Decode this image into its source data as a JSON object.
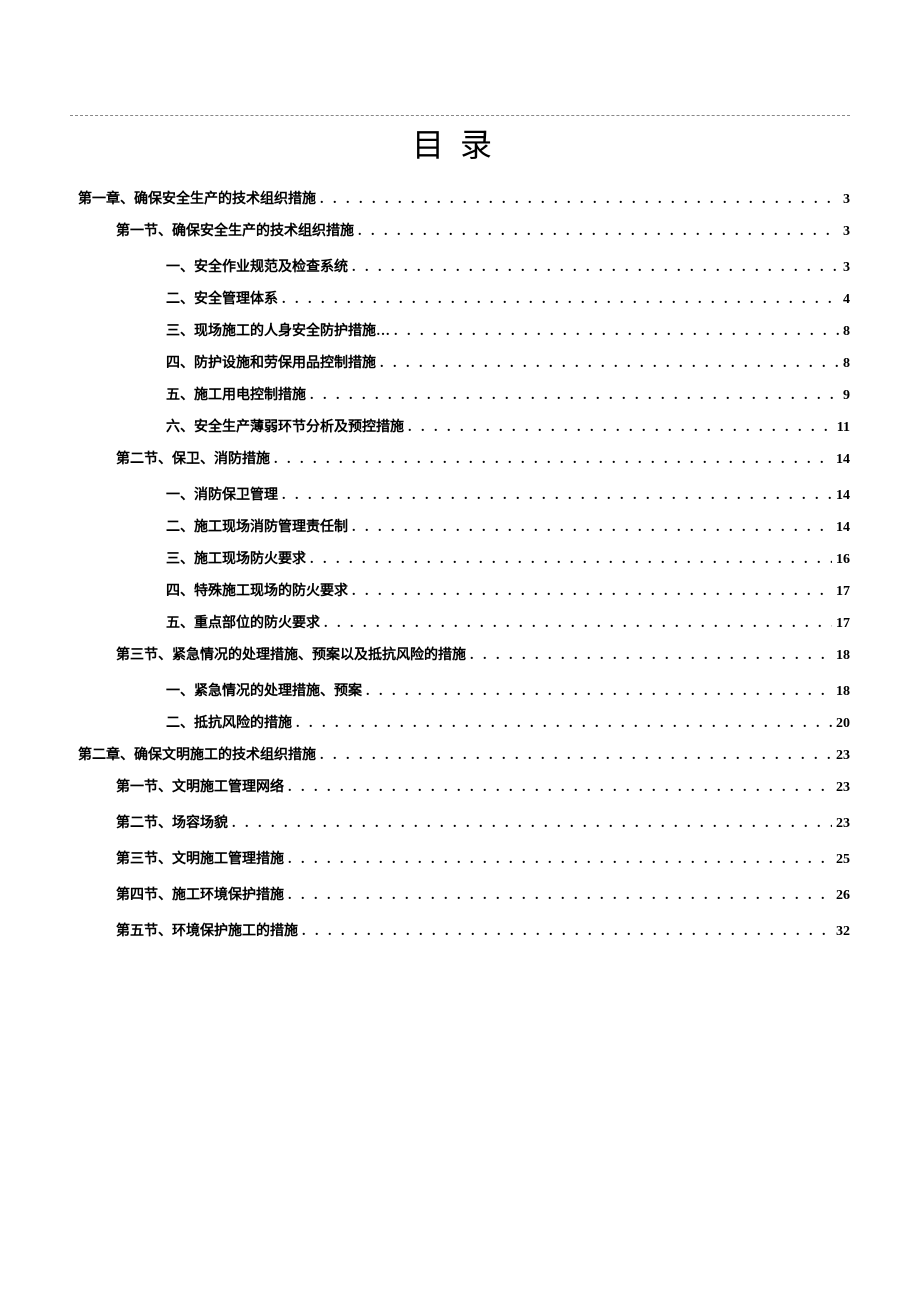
{
  "title": "目录",
  "toc": [
    {
      "level": 0,
      "label": "第一章、确保安全生产的技术组织措施",
      "page": "3"
    },
    {
      "level": 1,
      "label": "第一节、确保安全生产的技术组织措施",
      "page": "3"
    },
    {
      "level": 2,
      "label": "一、安全作业规范及检查系统",
      "page": "3"
    },
    {
      "level": 2,
      "label": "二、安全管理体系",
      "page": "4"
    },
    {
      "level": 2,
      "label": "三、现场施工的人身安全防护措施…",
      "page": "8"
    },
    {
      "level": 2,
      "label": "四、防护设施和劳保用品控制措施",
      "page": "8"
    },
    {
      "level": 2,
      "label": "五、施工用电控制措施",
      "page": "9"
    },
    {
      "level": 2,
      "label": "六、安全生产薄弱环节分析及预控措施",
      "page": "11"
    },
    {
      "level": 1,
      "label": "第二节、保卫、消防措施",
      "page": "14"
    },
    {
      "level": 2,
      "label": "一、消防保卫管理",
      "page": "14"
    },
    {
      "level": 2,
      "label": "二、施工现场消防管理责任制",
      "page": "14"
    },
    {
      "level": 2,
      "label": "三、施工现场防火要求",
      "page": "16"
    },
    {
      "level": 2,
      "label": "四、特殊施工现场的防火要求",
      "page": "17"
    },
    {
      "level": 2,
      "label": "五、重点部位的防火要求",
      "page": "17"
    },
    {
      "level": 1,
      "label": "第三节、紧急情况的处理措施、预案以及抵抗风险的措施",
      "page": "18"
    },
    {
      "level": 2,
      "label": "一、紧急情况的处理措施、预案",
      "page": "18"
    },
    {
      "level": 2,
      "label": "二、抵抗风险的措施",
      "page": "20"
    },
    {
      "level": 0,
      "label": "第二章、确保文明施工的技术组织措施",
      "page": "23"
    },
    {
      "level": 1,
      "label": "第一节、文明施工管理网络",
      "page": "23"
    },
    {
      "level": 1,
      "label": "第二节、场容场貌",
      "page": "23"
    },
    {
      "level": 1,
      "label": "第三节、文明施工管理措施",
      "page": "25"
    },
    {
      "level": 1,
      "label": "第四节、施工环境保护措施",
      "page": "26"
    },
    {
      "level": 1,
      "label": "第五节、环境保护施工的措施",
      "page": "32"
    }
  ]
}
